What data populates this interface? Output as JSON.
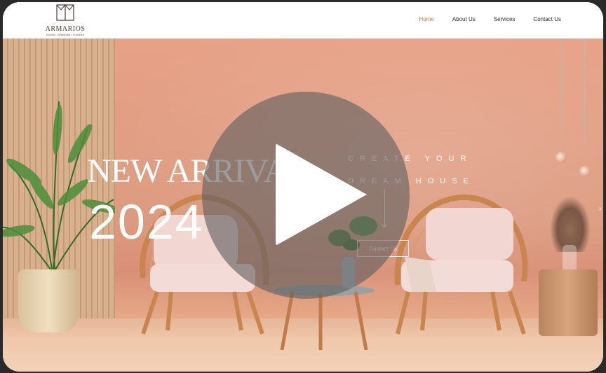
{
  "brand": {
    "name": "ARMARIOS",
    "tagline": "Kitchen • Wardrobe • Furniture"
  },
  "nav": {
    "items": [
      "Home",
      "About Us",
      "Services",
      "Contact Us"
    ],
    "active": "Home"
  },
  "hero": {
    "headline": "NEW ARRIVAL",
    "year": "2024",
    "tagline_line1": "CREATE YOUR",
    "tagline_line2": "DREAM HOUSE",
    "cta_label": "Contact Us",
    "next_icon": "chevron-right-icon"
  },
  "video": {
    "play_icon": "play-icon"
  },
  "colors": {
    "accent": "#e0783f",
    "hero_wall": "#dc9a7f",
    "overlay": "#5f5f5f"
  }
}
